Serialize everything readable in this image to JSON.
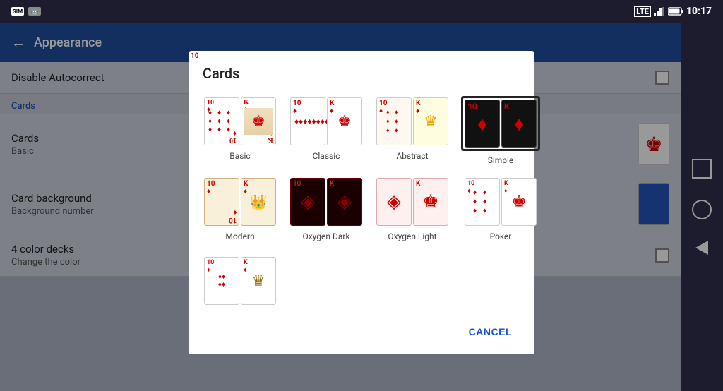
{
  "statusBar": {
    "time": "10:17",
    "lteLabel": "LTE",
    "batteryLevel": 85
  },
  "header": {
    "backLabel": "←",
    "title": "Appearance"
  },
  "settings": {
    "disableAutoCorrect": {
      "title": "Disable Autocorrect",
      "subtitle": ""
    },
    "sectionLabel": "Cards",
    "cards": {
      "title": "Cards",
      "subtitle": "Basic"
    },
    "cardBackground": {
      "title": "Card background",
      "subtitle": "Background number"
    },
    "fourColorDecks": {
      "title": "4 color decks",
      "subtitle": "Change the color"
    }
  },
  "dialog": {
    "title": "Cards",
    "cancelLabel": "CANCEL",
    "options": [
      {
        "id": "basic",
        "label": "Basic",
        "selected": false
      },
      {
        "id": "classic",
        "label": "Classic",
        "selected": false
      },
      {
        "id": "abstract",
        "label": "Abstract",
        "selected": false
      },
      {
        "id": "simple",
        "label": "Simple",
        "selected": true
      },
      {
        "id": "modern",
        "label": "Modern",
        "selected": false
      },
      {
        "id": "oxygen-dark",
        "label": "Oxygen Dark",
        "selected": false
      },
      {
        "id": "oxygen-light",
        "label": "Oxygen Light",
        "selected": false
      },
      {
        "id": "poker",
        "label": "Poker",
        "selected": false
      },
      {
        "id": "extra1",
        "label": "",
        "selected": false
      },
      {
        "id": "extra2",
        "label": "",
        "selected": false
      }
    ]
  },
  "nav": {
    "squareLabel": "□",
    "circleLabel": "○",
    "backLabel": "◁"
  }
}
